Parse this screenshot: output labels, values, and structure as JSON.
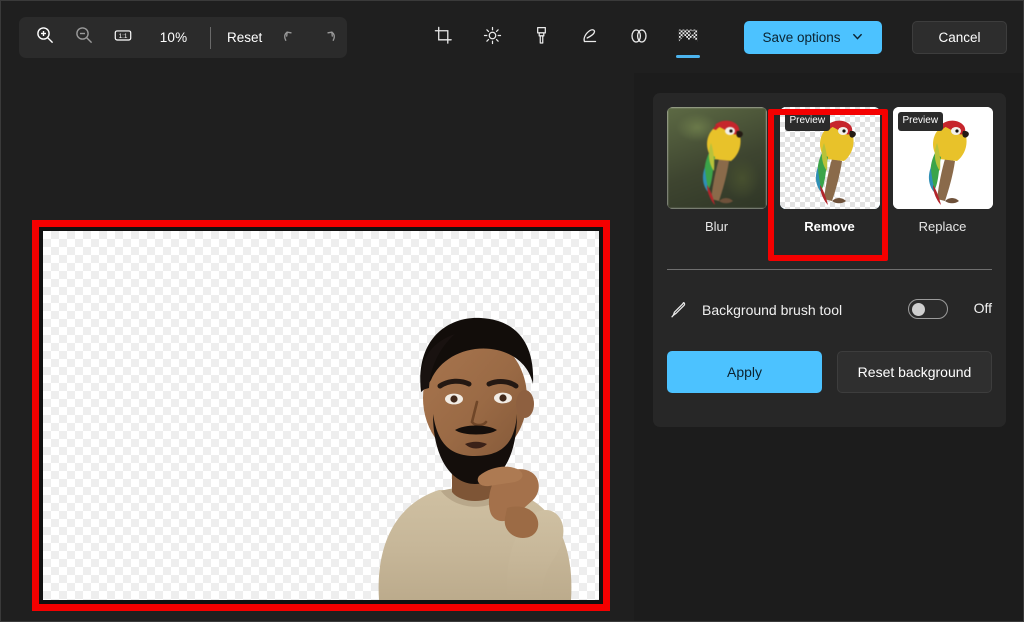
{
  "toolbar": {
    "zoom_in_icon": "zoom-in-icon",
    "zoom_out_icon": "zoom-out-icon",
    "actual_size_icon": "one-to-one-icon",
    "zoom_level": "10%",
    "reset_label": "Reset",
    "undo_icon": "undo-icon",
    "redo_icon": "redo-icon",
    "edit_tools": [
      {
        "name": "crop",
        "icon": "crop-icon",
        "selected": false
      },
      {
        "name": "adjustments",
        "icon": "brightness-icon",
        "selected": false
      },
      {
        "name": "markup",
        "icon": "paintbrush-icon",
        "selected": false
      },
      {
        "name": "erase",
        "icon": "pen-erase-icon",
        "selected": false
      },
      {
        "name": "retouch",
        "icon": "spot-fix-icon",
        "selected": false
      },
      {
        "name": "background",
        "icon": "background-icon",
        "selected": true
      }
    ],
    "save_options_label": "Save options",
    "save_options_chevron": "chevron-down-icon",
    "cancel_label": "Cancel"
  },
  "canvas": {
    "transparency": "checkerboard",
    "annotation_color": "#f40000",
    "subject_alt": "person-cutout"
  },
  "panel": {
    "background_options": [
      {
        "label": "Blur",
        "preview_badge": null,
        "selected": false,
        "thumb": "blurred-parrot"
      },
      {
        "label": "Remove",
        "preview_badge": "Preview",
        "selected": true,
        "thumb": "transparent-parrot"
      },
      {
        "label": "Replace",
        "preview_badge": "Preview",
        "selected": false,
        "thumb": "white-parrot"
      }
    ],
    "brush": {
      "icon": "paintbrush-icon",
      "label": "Background brush tool",
      "state": "Off",
      "enabled": false
    },
    "apply_label": "Apply",
    "reset_background_label": "Reset background"
  },
  "colors": {
    "accent": "#4cc2ff",
    "annotation": "#f40000",
    "panel_bg": "#1c1c1c",
    "card_bg": "#272727",
    "app_bg": "#1f1f1f"
  }
}
